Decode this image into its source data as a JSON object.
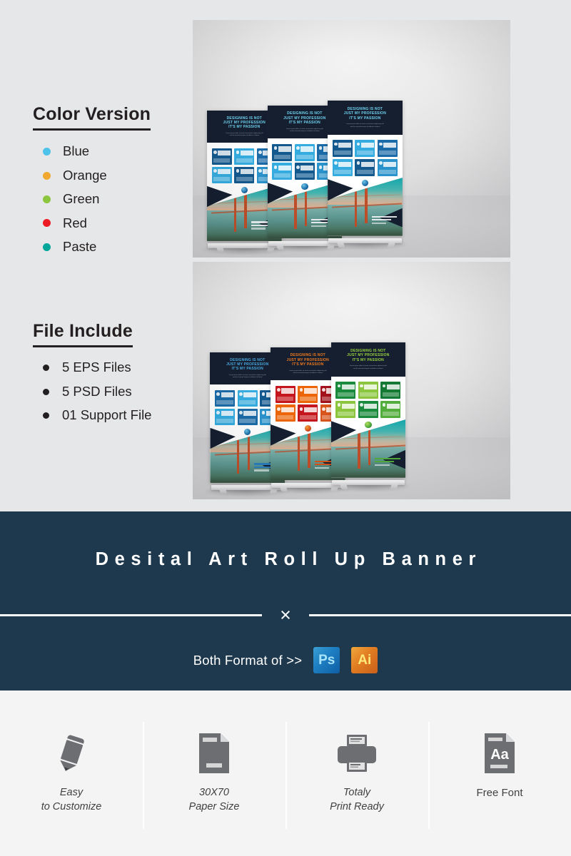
{
  "colors": {
    "page_bg": "#e6e7e8",
    "features_bg": "#f4f4f5",
    "navy": "#1e394e",
    "banner_header_navy": "#151f30",
    "text_dark": "#231f20",
    "icon_gray": "#6d6e71"
  },
  "color_version": {
    "heading": "Color Version",
    "swatches": [
      {
        "label": "Blue",
        "hex": "#4ec3ea"
      },
      {
        "label": "Orange",
        "hex": "#f0a830"
      },
      {
        "label": "Green",
        "hex": "#8cc63e"
      },
      {
        "label": "Red",
        "hex": "#ed1b24"
      },
      {
        "label": "Paste",
        "hex": "#00a79a"
      }
    ]
  },
  "file_include": {
    "heading": "File Include",
    "items": [
      "5 EPS Files",
      "5 PSD Files",
      "01 Support File"
    ]
  },
  "mockups": {
    "top": {
      "name": "blue-rollup-banner-trio-mockup",
      "headline": "DESIGNING IS NOT JUST MY PROFESSION IT'S MY PASSION",
      "banners": [
        {
          "variant": "Blue",
          "accent": "#1b6ba8",
          "accent2": "#35ace0",
          "accent3": "#14598e"
        },
        {
          "variant": "Blue",
          "accent": "#1b6ba8",
          "accent2": "#35ace0",
          "accent3": "#14598e"
        },
        {
          "variant": "Blue",
          "accent": "#1b6ba8",
          "accent2": "#35ace0",
          "accent3": "#14598e"
        }
      ]
    },
    "bottom": {
      "name": "multicolor-rollup-banner-trio-mockup",
      "headline": "DESIGNING IS NOT JUST MY PROFESSION IT'S MY PASSION",
      "banners": [
        {
          "variant": "Blue",
          "accent": "#1b6ba8",
          "accent2": "#35ace0",
          "accent3": "#14598e"
        },
        {
          "variant": "Red",
          "accent": "#c4161c",
          "accent2": "#ec6608",
          "accent3": "#a3121a"
        },
        {
          "variant": "Green",
          "accent": "#1a8a3c",
          "accent2": "#8cc63e",
          "accent3": "#147a33"
        }
      ]
    }
  },
  "banner": {
    "title": "Desital Art Roll Up Banner",
    "divider_icon": "×",
    "format_text": "Both Format of >>",
    "formats": [
      {
        "name": "photoshop-icon",
        "label": "Ps"
      },
      {
        "name": "illustrator-icon",
        "label": "Ai"
      }
    ]
  },
  "features": [
    {
      "icon": "pencil-icon",
      "line1": "Easy",
      "line2": "to Customize",
      "italic": true
    },
    {
      "icon": "document-icon",
      "line1": "30X70",
      "line2": "Paper Size",
      "italic": true
    },
    {
      "icon": "printer-icon",
      "line1": "Totaly",
      "line2": "Print Ready",
      "italic": true
    },
    {
      "icon": "font-file-icon",
      "line1": "Free Font",
      "line2": "",
      "italic": false
    }
  ]
}
